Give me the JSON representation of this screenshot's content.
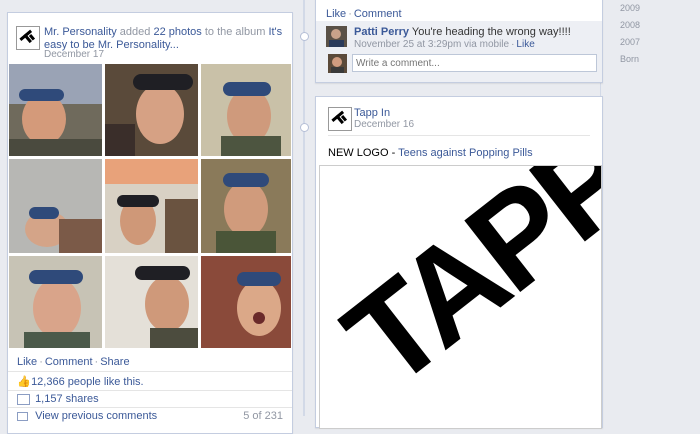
{
  "post1": {
    "author": "Mr. Personality",
    "action_pre": " added ",
    "photo_count": "22 photos",
    "action_post": " to the album ",
    "album": "It's easy to be Mr. Personality...",
    "date": "December 17",
    "actions": {
      "like": "Like",
      "comment": "Comment",
      "share": "Share"
    },
    "likes": "12,366 people like this.",
    "shares": "1,157 shares",
    "view_prev": "View previous comments",
    "comment_count": "5 of 231"
  },
  "post_prev": {
    "actions": {
      "like": "Like",
      "comment": "Comment"
    },
    "comment": {
      "author": "Patti Perry",
      "text": " You're heading the wrong way!!!!",
      "meta": "November 25 at 3:29pm via mobile",
      "like": "Like"
    },
    "write_placeholder": "Write a comment..."
  },
  "post2": {
    "author": "Tapp In",
    "date": "December 16",
    "title": "NEW LOGO",
    "dash": " - ",
    "subtitle": "Teens against Popping Pills",
    "logo_text": "TAPP IN."
  },
  "years": [
    "2009",
    "2008",
    "2007",
    "Born"
  ],
  "colors": {
    "link": "#3b5998",
    "card_border": "#c4cde0",
    "bg": "#e9ebf0"
  }
}
